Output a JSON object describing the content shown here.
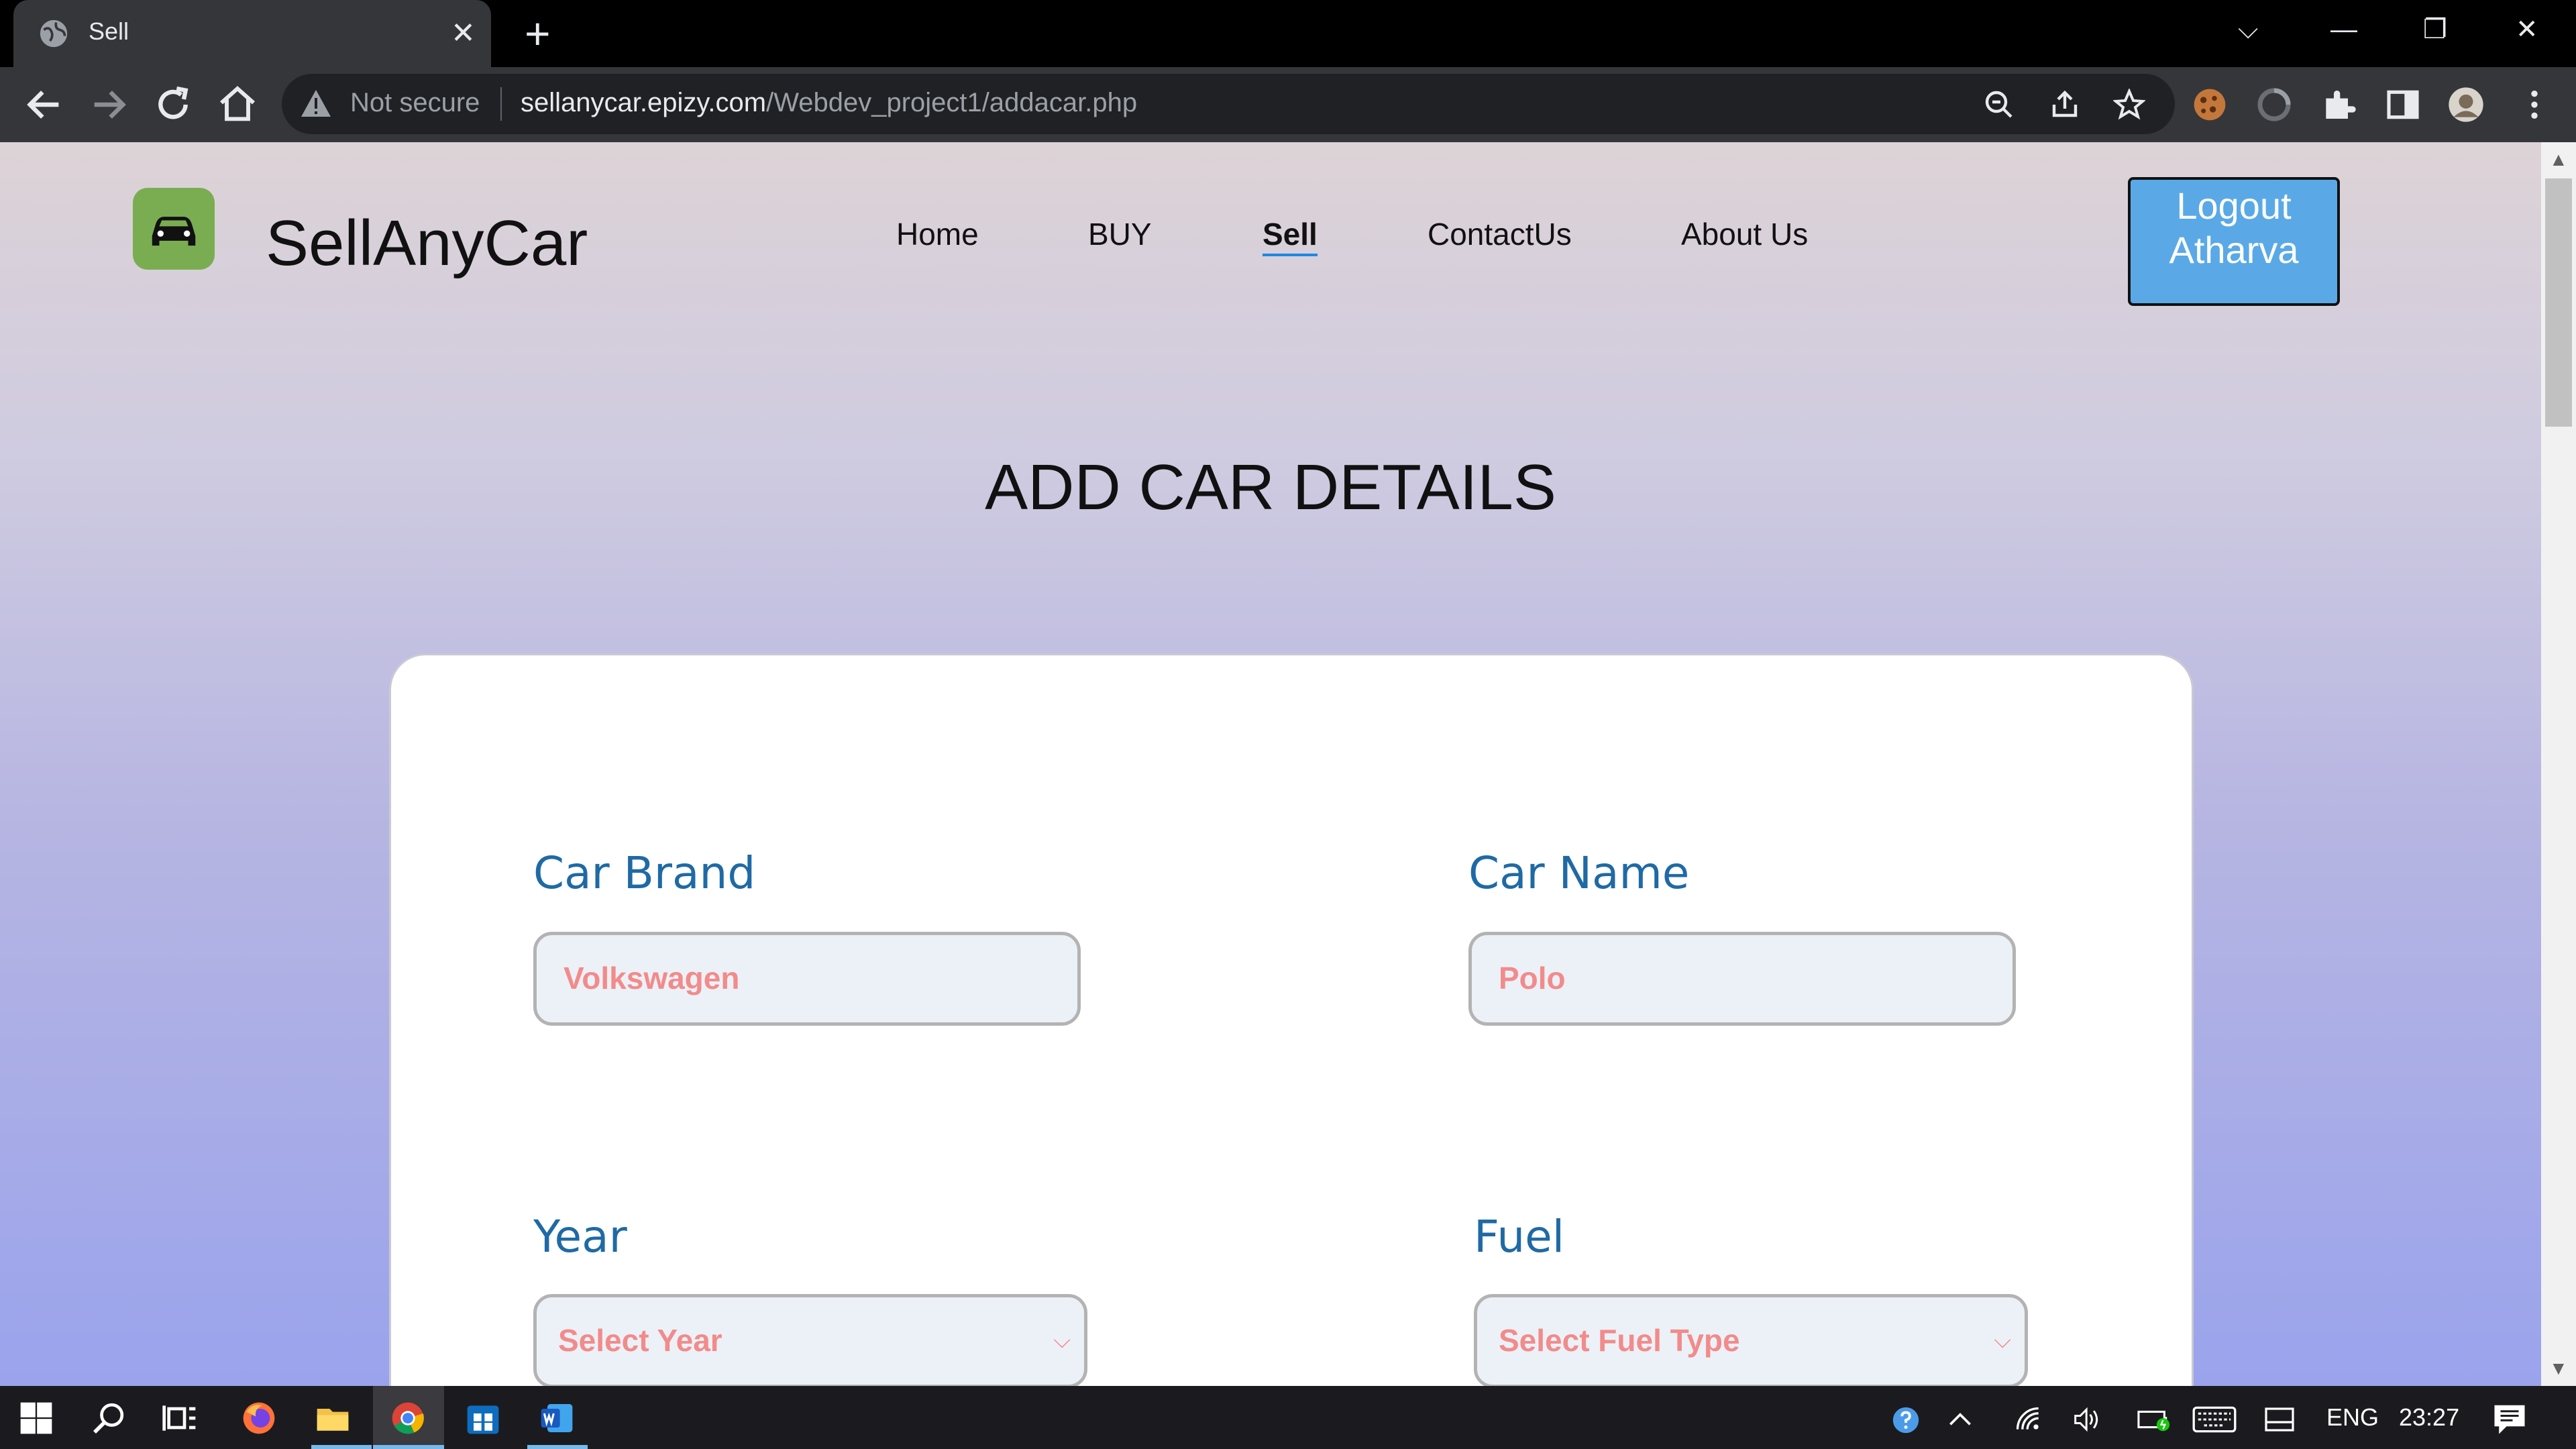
{
  "browser": {
    "tab_title": "Sell",
    "tab_close": "✕",
    "new_tab": "+",
    "not_secure": "Not secure",
    "url_host": "sellanycar.epizy.com",
    "url_path": "/Webdev_project1/addacar.php",
    "window_controls": {
      "dropdown": "⌵",
      "minimize": "—",
      "restore": "❐",
      "close": "✕"
    }
  },
  "site": {
    "brand": "SellAnyCar",
    "nav": [
      {
        "label": "Home"
      },
      {
        "label": "BUY"
      },
      {
        "label": "Sell",
        "active": true
      },
      {
        "label": "ContactUs"
      },
      {
        "label": "About Us"
      }
    ],
    "logout_line1": "Logout",
    "logout_line2": "Atharva",
    "heading": "ADD CAR DETAILS"
  },
  "form": {
    "car_brand": {
      "label": "Car Brand",
      "value": "Volkswagen"
    },
    "car_name": {
      "label": "Car Name",
      "value": "Polo"
    },
    "year": {
      "label": "Year",
      "selected": "Select Year"
    },
    "fuel": {
      "label": "Fuel",
      "selected": "Select Fuel Type"
    }
  },
  "taskbar": {
    "language": "ENG",
    "time": "23:27"
  },
  "colors": {
    "accent": "#1e88e5",
    "logout_bg": "#5aa9e6",
    "label": "#1f6aa5",
    "placeholder": "#f28b8b",
    "logo_bg": "#7aad52"
  }
}
